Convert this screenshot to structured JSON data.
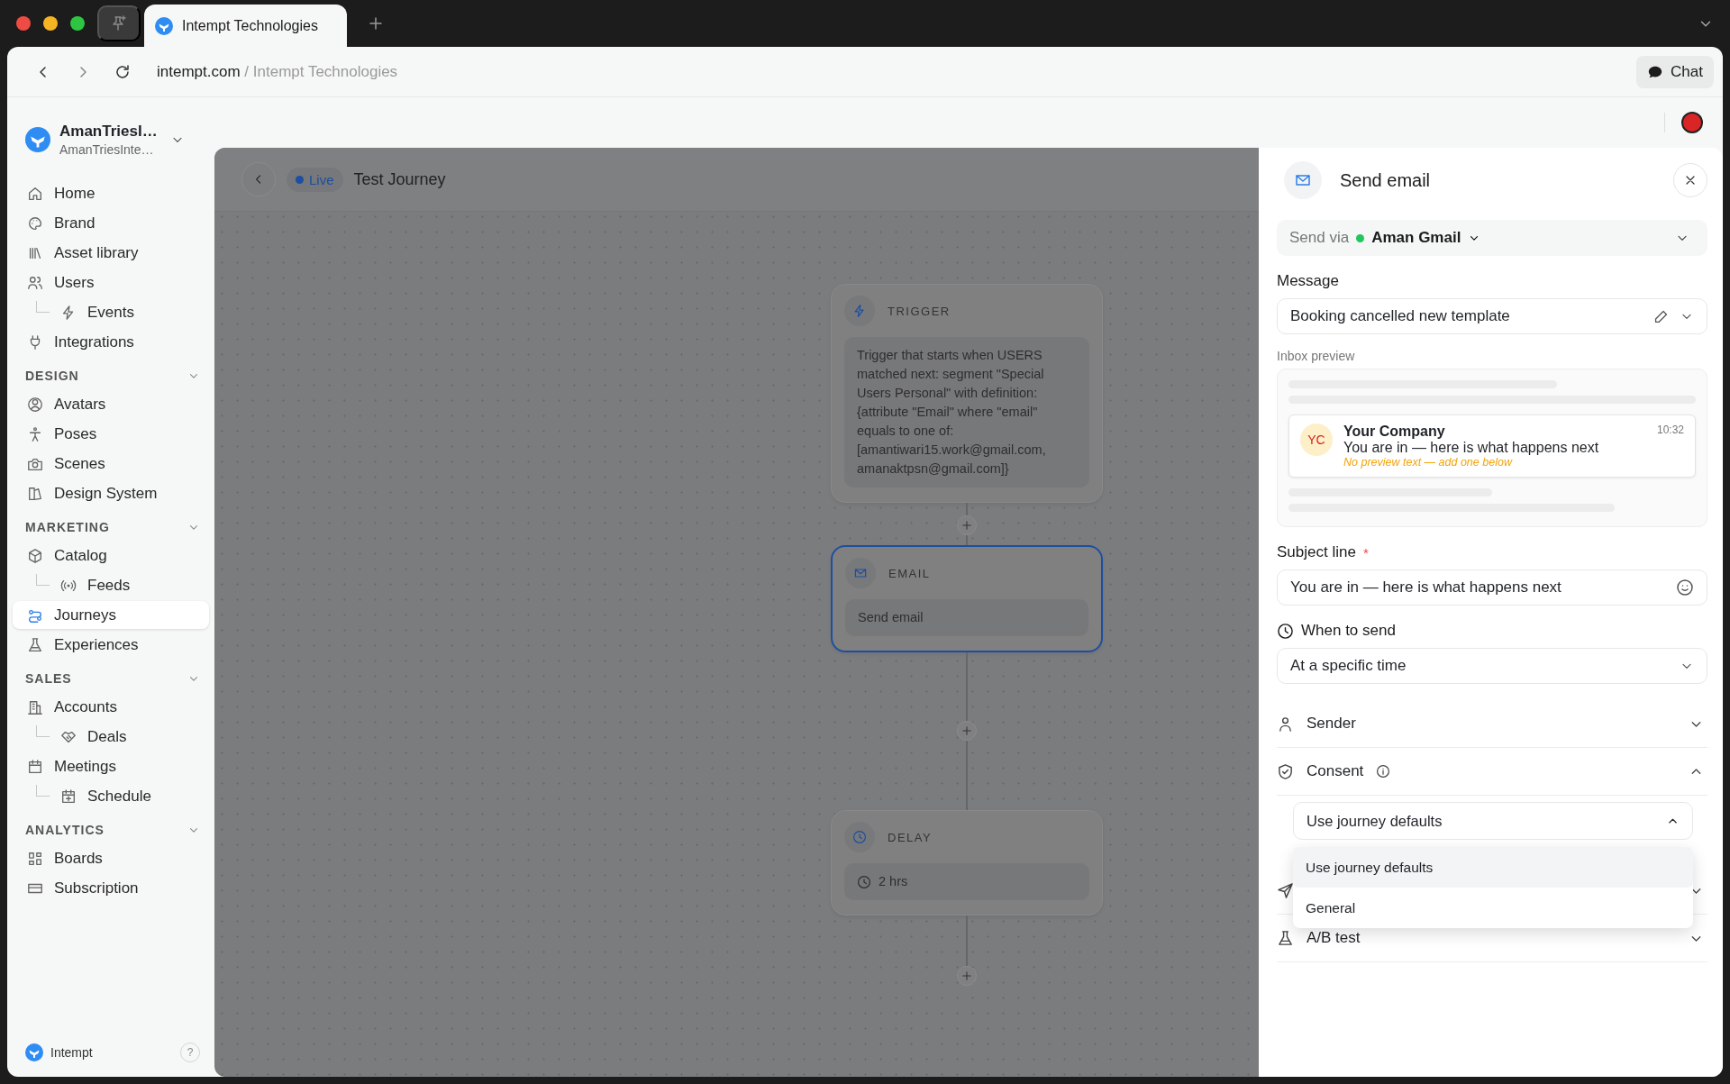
{
  "browser": {
    "tab_title": "Intempt Technologies",
    "url_domain": "intempt.com",
    "url_path": "/ Intempt Technologies",
    "chat_button": "Chat"
  },
  "sidebar": {
    "workspace": {
      "name": "AmanTriesI…",
      "subtitle": "AmanTriesInte…"
    },
    "groups": [
      {
        "items": [
          {
            "kind": "home",
            "label": "Home",
            "selected": false
          },
          {
            "kind": "brand",
            "label": "Brand",
            "selected": false
          },
          {
            "kind": "library",
            "label": "Asset library",
            "selected": false
          },
          {
            "kind": "users",
            "label": "Users",
            "selected": false,
            "children": [
              {
                "kind": "events",
                "label": "Events",
                "selected": false
              }
            ]
          },
          {
            "kind": "integrations",
            "label": "Integrations",
            "selected": false
          }
        ]
      },
      {
        "heading": "DESIGN",
        "expanded": true,
        "items": [
          {
            "kind": "avatars",
            "label": "Avatars",
            "selected": false
          },
          {
            "kind": "poses",
            "label": "Poses",
            "selected": false
          },
          {
            "kind": "scenes",
            "label": "Scenes",
            "selected": false
          },
          {
            "kind": "design-system",
            "label": "Design System",
            "selected": false
          }
        ]
      },
      {
        "heading": "MARKETING",
        "expanded": true,
        "items": [
          {
            "kind": "catalog",
            "label": "Catalog",
            "selected": false,
            "children": [
              {
                "kind": "feeds",
                "label": "Feeds",
                "selected": false
              }
            ]
          },
          {
            "kind": "journeys",
            "label": "Journeys",
            "selected": true
          },
          {
            "kind": "experiences",
            "label": "Experiences",
            "selected": false
          }
        ]
      },
      {
        "heading": "SALES",
        "expanded": true,
        "items": [
          {
            "kind": "accounts",
            "label": "Accounts",
            "selected": false,
            "children": [
              {
                "kind": "deals",
                "label": "Deals",
                "selected": false
              }
            ]
          },
          {
            "kind": "meetings",
            "label": "Meetings",
            "selected": false,
            "children": [
              {
                "kind": "schedule",
                "label": "Schedule",
                "selected": false
              }
            ]
          }
        ]
      },
      {
        "heading": "ANALYTICS",
        "expanded": true,
        "items": [
          {
            "kind": "boards",
            "label": "Boards",
            "selected": false
          },
          {
            "kind": "subscription",
            "label": "Subscription",
            "selected": false
          }
        ]
      }
    ],
    "footer": {
      "brand": "Intempt",
      "help": "?"
    }
  },
  "journey": {
    "status": "Live",
    "title": "Test Journey",
    "nodes": [
      {
        "kind": "trigger",
        "label": "TRIGGER",
        "body": "Trigger that starts when USERS matched next: segment \"Special Users Personal\" with definition: {attribute \"Email\" where \"email\" equals to one of: [amantiwari15.work@gmail.com, amanaktpsn@gmail.com]}",
        "selected": false
      },
      {
        "kind": "email",
        "label": "EMAIL",
        "body": "Send email",
        "selected": true
      },
      {
        "kind": "delay",
        "label": "DELAY",
        "body": "2 hrs",
        "selected": false
      }
    ]
  },
  "panel": {
    "title": "Send email",
    "send_via": {
      "label": "Send via",
      "account": "Aman Gmail",
      "connected": true
    },
    "message": {
      "label": "Message",
      "value": "Booking cancelled new template"
    },
    "inbox_preview": {
      "label": "Inbox preview",
      "avatar": "YC",
      "sender": "Your Company",
      "time": "10:32",
      "subject": "You are in — here is what happens next",
      "preview": "No preview text — add one below"
    },
    "subject": {
      "label": "Subject line",
      "required_mark": "*",
      "value": "You are in — here is what happens next"
    },
    "when_to_send": {
      "label": "When to send",
      "value": "At a specific time"
    },
    "sections": [
      {
        "kind": "sender",
        "label": "Sender",
        "expanded": false
      },
      {
        "kind": "consent",
        "label": "Consent",
        "info": true,
        "expanded": true,
        "select": {
          "value": "Use journey defaults",
          "expanded": true,
          "options": [
            {
              "label": "Use journey defaults",
              "selected": true
            },
            {
              "label": "General",
              "selected": false
            }
          ]
        }
      },
      {
        "kind": "send",
        "expanded": false
      },
      {
        "kind": "ab-test",
        "label": "A/B test",
        "expanded": false
      }
    ]
  }
}
